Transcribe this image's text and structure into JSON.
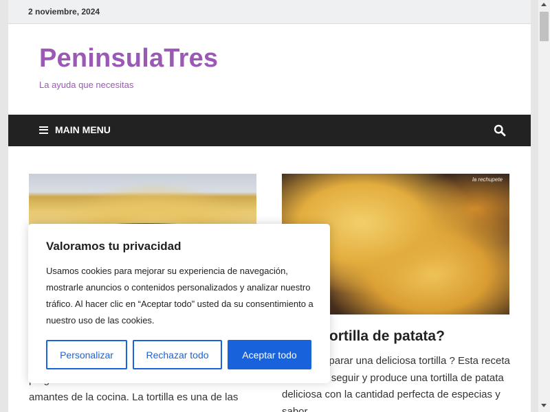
{
  "topbar": {
    "date": "2 noviembre, 2024"
  },
  "site": {
    "title": "PeninsulaTres",
    "description": "La ayuda que necesitas"
  },
  "nav": {
    "menu_label": "MAIN MENU",
    "menu_icon": "hamburger-icon",
    "search_icon": "search-icon"
  },
  "posts": [
    {
      "excerpt": "pregunta es una de las más frecuentes entre los amantes de la cocina. La tortilla es una de las"
    },
    {
      "title": "hacer tortilla de patata?",
      "excerpt": "o para preparar una deliciosa tortilla ? Esta receta es fácil de seguir y produce una tortilla de patata deliciosa con la cantidad perfecta de especias y sabor.",
      "image_watermark": "la rechupete"
    }
  ],
  "cookie_banner": {
    "title": "Valoramos tu privacidad",
    "text": "Usamos cookies para mejorar su experiencia de navegación, mostrarle anuncios o contenidos personalizados y analizar nuestro tráfico. Al hacer clic en “Aceptar todo” usted da su consentimiento a nuestro uso de las cookies.",
    "customize_label": "Personalizar",
    "reject_label": "Rechazar todo",
    "accept_label": "Aceptar todo"
  },
  "colors": {
    "brand": "#9b59b6",
    "nav_bg": "#222222",
    "button_accent": "#1863dc"
  }
}
